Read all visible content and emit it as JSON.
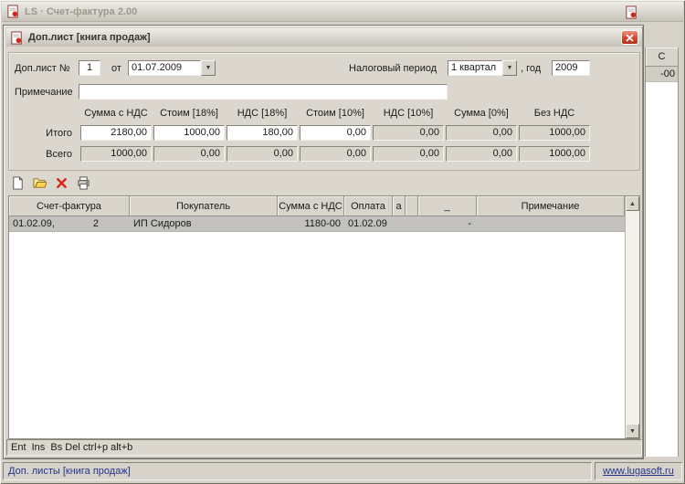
{
  "window": {
    "title": "LS · Счет-фактура 2.00"
  },
  "background_grid": {
    "column_header": "С",
    "visible_cell": "-00"
  },
  "dialog": {
    "title": "Доп.лист [книга продаж]",
    "form": {
      "sheet_no_label": "Доп.лист №",
      "sheet_no_value": "1",
      "from_label": "от",
      "date_value": "01.07.2009",
      "tax_period_label": "Налоговый период",
      "tax_period_value": "1 квартал",
      "year_label": ", год",
      "year_value": "2009",
      "note_label": "Примечание",
      "note_value": ""
    },
    "totals": {
      "headers": [
        "Сумма с НДС",
        "Стоим [18%]",
        "НДС [18%]",
        "Стоим [10%]",
        "НДС [10%]",
        "Сумма [0%]",
        "Без НДС"
      ],
      "itogo_label": "Итого",
      "itogo": [
        "2180,00",
        "1000,00",
        "180,00",
        "0,00",
        "0,00",
        "0,00",
        "1000,00"
      ],
      "vsego_label": "Всего",
      "vsego": [
        "1000,00",
        "0,00",
        "0,00",
        "0,00",
        "0,00",
        "0,00",
        "1000,00"
      ]
    },
    "toolbar": {
      "icons": [
        "new-document-icon",
        "open-folder-icon",
        "delete-icon",
        "print-icon"
      ]
    },
    "grid": {
      "headers": [
        "Счет-фактура",
        "Покупатель",
        "Сумма с НДС",
        "Оплата",
        "а",
        "",
        "_",
        "Примечание"
      ],
      "row": {
        "date": "01.02.09,",
        "number": "2",
        "buyer": "ИП Сидоров",
        "sum": "1180-00",
        "payment": "01.02.09",
        "a": "",
        "b": "",
        "flag": "-",
        "note": ""
      }
    },
    "status_hint": "Ent  Ins  Bs Del ctrl+p alt+b"
  },
  "status_bar": {
    "left": "Доп. листы [книга продаж]",
    "right_link": "www.lugasoft.ru"
  },
  "icons": {
    "dropdown_glyph": "▼",
    "scroll_up_glyph": "▲",
    "scroll_down_glyph": "▼"
  },
  "colors": {
    "window_bg": "#d6d2c9",
    "dialog_bg": "#dbd7ce",
    "selected_row": "#c2c1bd",
    "close_button": "#d8452e",
    "link": "#23338f"
  }
}
